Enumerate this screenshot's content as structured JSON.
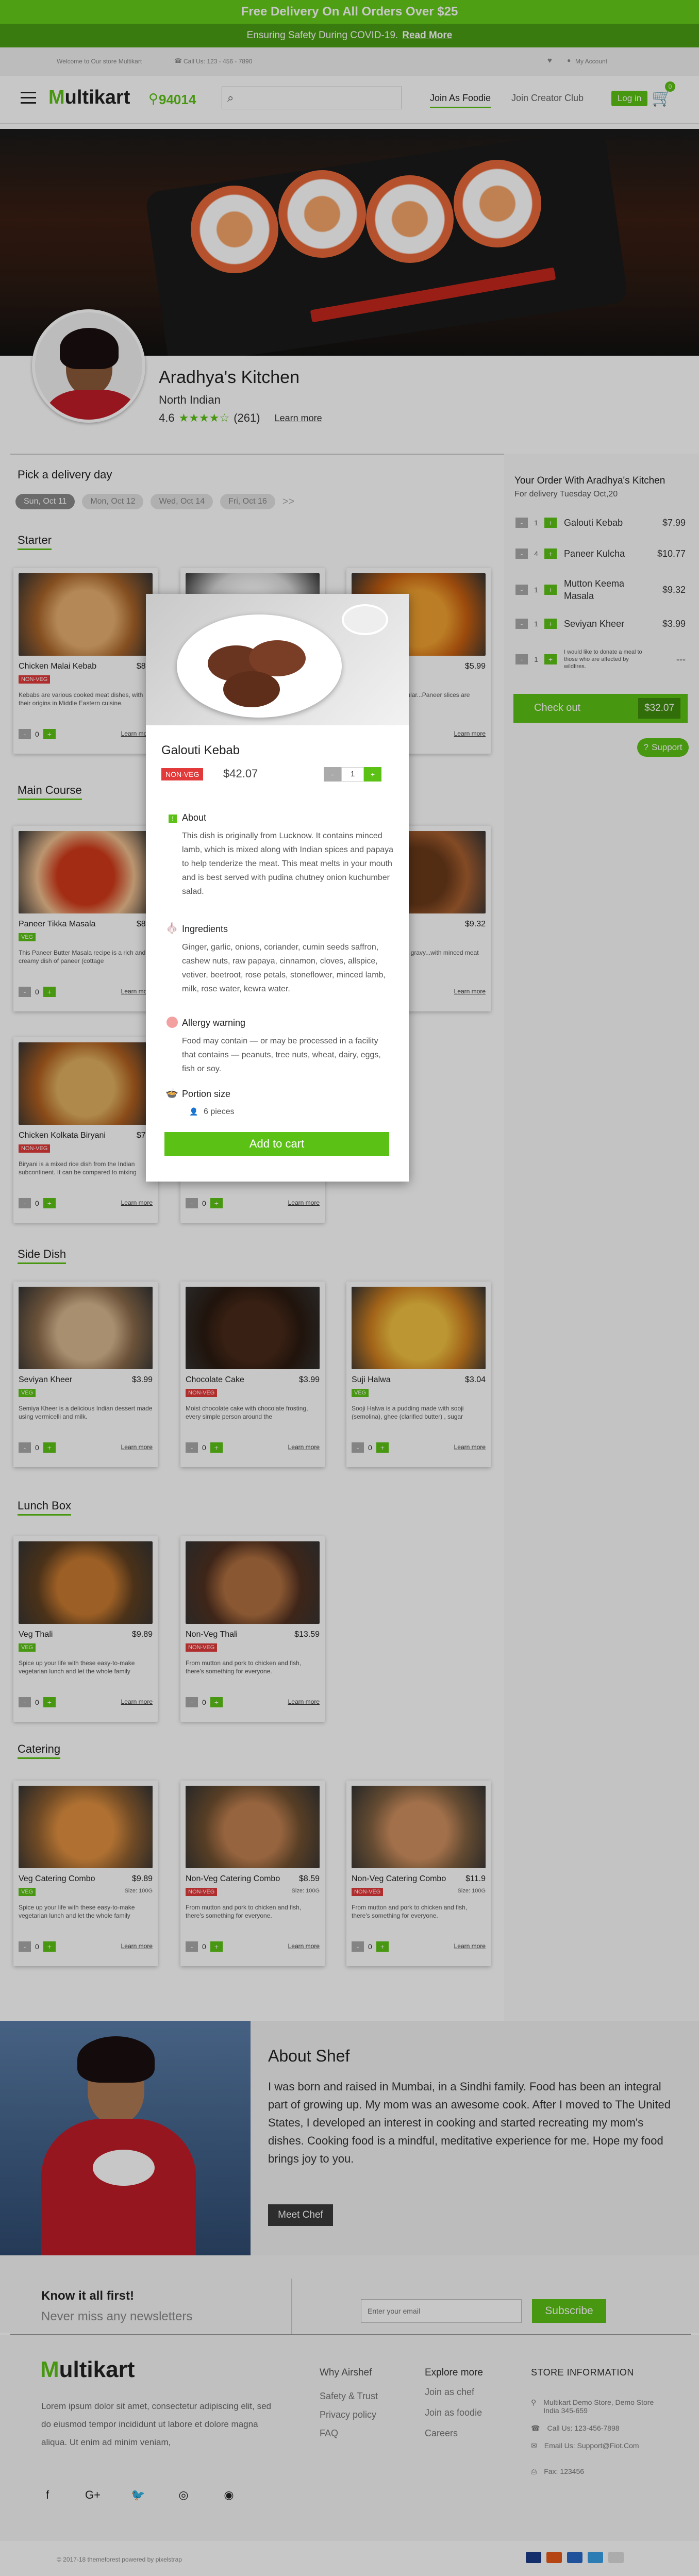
{
  "promo": {
    "top": "Free Delivery On All Orders Over $25",
    "covid": "Ensuring Safety During COVID-19.",
    "covid_link": "Read More"
  },
  "topbar": {
    "welcome": "Welcome to Our store Multikart",
    "phone": "Call Us: 123 - 456 - 7890",
    "account": "My Account"
  },
  "nav": {
    "logo": "ultikart",
    "logo_m": "M",
    "zip": "94014",
    "search_placeholder": "",
    "join_foodie": "Join As Foodie",
    "join_creator": "Join Creator Club",
    "login": "Log in",
    "cart_count": "0"
  },
  "kitchen": {
    "name": "Aradhya's Kitchen",
    "cuisine": "North Indian",
    "rating": "4.6",
    "stars": "★★★★☆",
    "reviews": "(261)",
    "learn_more": "Learn more",
    "rating_value": 4.6
  },
  "delivery": {
    "title": "Pick a delivery day",
    "days": [
      "Sun, Oct 11",
      "Mon, Oct 12",
      "Wed, Oct 14",
      "Fri, Oct 16"
    ],
    "more": ">>"
  },
  "sections": {
    "starter": "Starter",
    "main": "Main  Course",
    "side": "Side Dish",
    "lunch": "Lunch Box",
    "catering": "Catering"
  },
  "common": {
    "learn_more": "Learn more",
    "qty": "0",
    "minus": "-",
    "plus": "+"
  },
  "starter": [
    {
      "name": "Chicken Malai Kebab",
      "price": "$8.9",
      "tag": "NON-VEG",
      "desc": "Kebabs are various cooked meat dishes, with their origins in Middle Eastern cuisine."
    },
    {
      "name": "",
      "price": "",
      "tag": "",
      "desc": ""
    },
    {
      "name": "la",
      "price": "$5.99",
      "tag": "",
      "desc": "...are deep fried popular...Paneer slices are"
    }
  ],
  "main": [
    {
      "name": "Paneer Tikka Masala",
      "price": "$8.9",
      "tag": "VEG",
      "desc": "This Paneer Butter Masala recipe is a rich and creamy dish of paneer (cottage"
    },
    {
      "name": "Masala",
      "price": "$9.32",
      "tag": "",
      "desc": "...Masala Recipe is a gravy...with minced meat and"
    },
    {
      "name": "Chicken Kolkata Biryani",
      "price": "$7.3",
      "tag": "NON-VEG",
      "desc": "Biryani is a mixed rice dish from the Indian subcontinent. It can be compared to mixing"
    }
  ],
  "side": [
    {
      "name": "Seviyan Kheer",
      "price": "$3.99",
      "tag": "VEG",
      "desc": "Semiya Kheer is a delicious Indian dessert made using vermicelli and milk."
    },
    {
      "name": "Chocolate Cake",
      "price": "$3.99",
      "tag": "NON-VEG",
      "desc": "Moist chocolate cake with chocolate frosting, every simple person around the"
    },
    {
      "name": "Suji Halwa",
      "price": "$3.04",
      "tag": "VEG",
      "desc": "Sooji Halwa is a pudding made with sooji (semolina), ghee (clarified butter) , sugar"
    }
  ],
  "lunch": [
    {
      "name": "Veg Thali",
      "price": "$9.89",
      "tag": "VEG",
      "desc": "Spice up your life with these easy-to-make vegetarian lunch and let the whole family"
    },
    {
      "name": "Non-Veg Thali",
      "price": "$13.59",
      "tag": "NON-VEG",
      "desc": "From mutton and pork to chicken and fish, there's something for everyone."
    }
  ],
  "catering": [
    {
      "name": "Veg Catering Combo",
      "price": "$9.89",
      "tag": "VEG",
      "serve": "Size: 100G",
      "desc": "Spice up your life with these easy-to-make vegetarian lunch and let the whole family"
    },
    {
      "name": "Non-Veg Catering Combo",
      "price": "$8.59",
      "tag": "NON-VEG",
      "serve": "Size: 100G",
      "desc": "From mutton and pork to chicken and fish, there's something for everyone."
    },
    {
      "name": "Non-Veg Catering Combo",
      "price": "$11.9",
      "tag": "NON-VEG",
      "serve": "Size: 100G",
      "desc": "From mutton and pork to chicken and fish, there's something for everyone."
    }
  ],
  "modal": {
    "title": "Galouti Kebab",
    "tag": "NON-VEG",
    "price": "$42.07",
    "qty": "1",
    "about_title": "About",
    "about": "This dish is originally from Lucknow. It contains minced lamb, which is mixed along with Indian spices and papaya to help tenderize the meat. This meat melts in your mouth and is best served with pudina chutney onion kuchumber salad.",
    "ingredients_title": "Ingredients",
    "ingredients": "Ginger, garlic, onions, coriander, cumin seeds saffron, cashew nuts, raw papaya, cinnamon, cloves, allspice, vetiver, beetroot, rose petals, stoneflower, minced lamb, milk, rose water, kewra water.",
    "allergy_title": "Allergy warning",
    "allergy": "Food may contain — or may be processed in a facility that contains — peanuts, tree nuts, wheat, dairy, eggs, fish or soy.",
    "portion_title": "Portion size",
    "portion": "6 pieces",
    "add_to_cart": "Add to cart"
  },
  "order": {
    "title": "Your Order With Aradhya's Kitchen",
    "subtitle": "For delivery Tuesday Oct,20",
    "items": [
      {
        "qty": "1",
        "name": "Galouti Kebab",
        "price": "$7.99"
      },
      {
        "qty": "4",
        "name": "Paneer Kulcha",
        "price": "$10.77"
      },
      {
        "qty": "1",
        "name": "Mutton Keema Masala",
        "price": "$9.32"
      },
      {
        "qty": "1",
        "name": "Seviyan Kheer",
        "price": "$3.99"
      },
      {
        "qty": "1",
        "name": "I would like to donate a meal to those who are affected by wildfires.",
        "price": "---"
      }
    ],
    "checkout": "Check out",
    "total": "$32.07",
    "support": "Support"
  },
  "about_chef": {
    "title": "About Shef",
    "text": "I was born and raised in Mumbai, in a Sindhi family. Food has been an integral part of growing up. My mom was an awesome cook. After I moved to The United States, I developed an interest in cooking and started recreating my mom's dishes. Cooking food is a mindful, meditative experience for me. Hope my food brings joy to you.",
    "button": "Meet Chef"
  },
  "newsletter": {
    "title": "Know it all first!",
    "subtitle": "Never miss any newsletters",
    "placeholder": "Enter your email",
    "button": "Subscribe"
  },
  "footer": {
    "about": "Lorem ipsum dolor sit amet, consectetur adipiscing elit, sed do eiusmod tempor incididunt ut labore et dolore magna aliqua. Ut enim ad minim veniam,",
    "why_title": "Why Airshef",
    "why": [
      "Safety & Trust",
      "Privacy policy",
      "FAQ"
    ],
    "explore_title": "Explore more",
    "explore": [
      "Join as chef",
      "Join as foodie",
      "Careers"
    ],
    "store_title": "STORE INFORMATION",
    "store": [
      "Multikart Demo Store, Demo Store India 345-659",
      "Call Us: 123-456-7898",
      "Email Us: Support@Fiot.Com",
      "Fax: 123456"
    ],
    "copyright": "© 2017-18 themeforest powered by pixelstrap"
  },
  "colors": {
    "brand": "#5bc215",
    "nonveg": "#e23a3a"
  }
}
